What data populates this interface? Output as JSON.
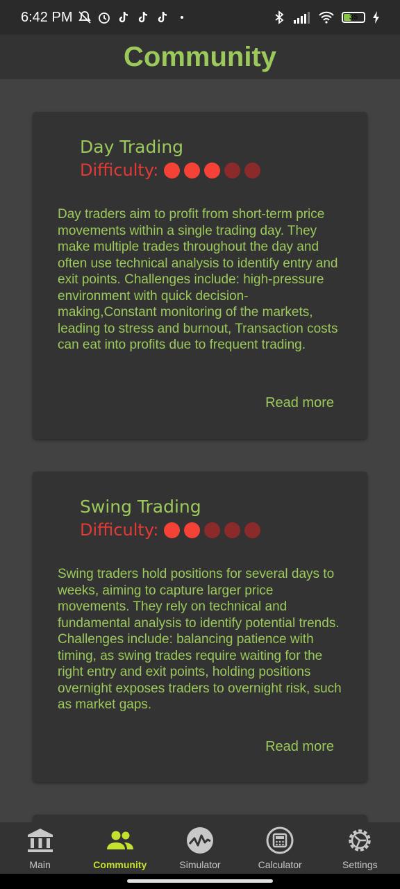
{
  "status_bar": {
    "time": "6:42 PM",
    "battery": "35"
  },
  "header": {
    "title": "Community"
  },
  "cards": [
    {
      "title": "Day Trading",
      "difficulty_label": "Difficulty:",
      "difficulty_level": 3,
      "difficulty_max": 5,
      "description": "Day traders aim to profit from short-term price movements within a single trading day. They make multiple trades throughout the day and often use technical analysis to identify entry and exit points. Challenges include: high-pressure environment with quick decision-making,Constant monitoring of the markets, leading to stress and burnout, Transaction costs can eat into profits due to frequent trading.",
      "link": "Read more"
    },
    {
      "title": "Swing Trading",
      "difficulty_label": "Difficulty:",
      "difficulty_level": 2,
      "difficulty_max": 5,
      "description": "Swing traders hold positions for several days to weeks, aiming to capture larger price movements. They rely on technical and fundamental analysis to identify potential trends. Challenges include: balancing patience with timing, as swing trades require waiting for the right entry and exit points, holding positions overnight exposes traders to overnight risk, such as market gaps.",
      "link": "Read more"
    }
  ],
  "nav": {
    "items": [
      {
        "label": "Main",
        "icon": "bank-icon"
      },
      {
        "label": "Community",
        "icon": "people-icon"
      },
      {
        "label": "Simulator",
        "icon": "chart-pulse-icon"
      },
      {
        "label": "Calculator",
        "icon": "calculator-icon"
      },
      {
        "label": "Settings",
        "icon": "gear-icon"
      }
    ],
    "active": "Community"
  },
  "colors": {
    "accent_green": "#9cc95b",
    "nav_active": "#c6e02f",
    "difficulty_red": "#f44336",
    "difficulty_dim": "#8b2a2a",
    "background": "#424242",
    "card": "#333333"
  }
}
